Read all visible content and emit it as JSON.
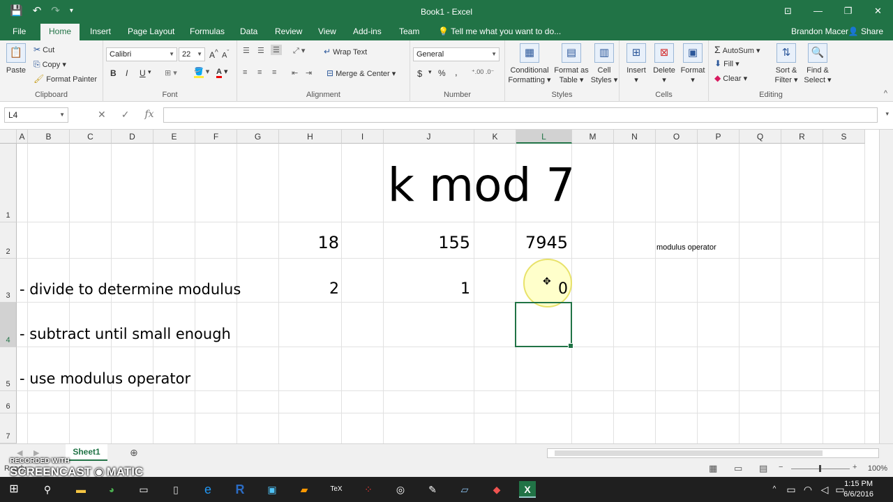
{
  "window": {
    "title": "Book1 - Excel",
    "qat": [
      "save-icon",
      "undo-icon",
      "redo-icon",
      "customize-icon"
    ]
  },
  "ribbon_tabs": [
    "File",
    "Home",
    "Insert",
    "Page Layout",
    "Formulas",
    "Data",
    "Review",
    "View",
    "Add-ins",
    "Team"
  ],
  "tell_me": "Tell me what you want to do...",
  "user": "Brandon Macer",
  "share": "Share",
  "clipboard": {
    "paste": "Paste",
    "cut": "Cut",
    "copy": "Copy",
    "format_painter": "Format Painter",
    "label": "Clipboard"
  },
  "font": {
    "name": "Calibri",
    "size": "22",
    "label": "Font",
    "bold": "B",
    "italic": "I",
    "underline": "U"
  },
  "alignment": {
    "wrap": "Wrap Text",
    "merge": "Merge & Center",
    "label": "Alignment"
  },
  "number": {
    "format": "General",
    "label": "Number",
    "currency": "$",
    "percent": "%",
    "comma": ","
  },
  "styles": {
    "conditional": [
      "Conditional",
      "Formatting"
    ],
    "format_table": [
      "Format as",
      "Table"
    ],
    "cell_styles": [
      "Cell",
      "Styles"
    ],
    "label": "Styles"
  },
  "cells": {
    "insert": "Insert",
    "delete": "Delete",
    "format": "Format",
    "label": "Cells"
  },
  "editing": {
    "autosum": "AutoSum",
    "fill": "Fill",
    "clear": "Clear",
    "sort": [
      "Sort &",
      "Filter"
    ],
    "find": [
      "Find &",
      "Select"
    ],
    "label": "Editing"
  },
  "formula_bar": {
    "name_box": "L4",
    "cancel": "✕",
    "enter": "✓",
    "fx": "fx",
    "formula": ""
  },
  "columns": [
    "A",
    "B",
    "C",
    "D",
    "E",
    "F",
    "G",
    "H",
    "I",
    "J",
    "K",
    "L",
    "M",
    "N",
    "O",
    "P",
    "Q",
    "R",
    "S"
  ],
  "rows": [
    "1",
    "2",
    "3",
    "4",
    "5",
    "6",
    "7"
  ],
  "cells_content": {
    "title": "k mod 7",
    "h2": "18",
    "j2": "155",
    "l2": "7945",
    "o2": "modulus operator",
    "b3": "- divide to determine modulus",
    "h3": "2",
    "j3": "1",
    "l3": "0",
    "b4": "- subtract until small enough",
    "b5": "- use modulus operator"
  },
  "sheet_tab": "Sheet1",
  "status": {
    "ready": "Ready",
    "zoom": "100%"
  },
  "watermark": {
    "line1": "RECORDED WITH",
    "line2": "SCREENCAST",
    "line3": "MATIC"
  },
  "clock": {
    "time": "1:15 PM",
    "date": "6/6/2016"
  }
}
